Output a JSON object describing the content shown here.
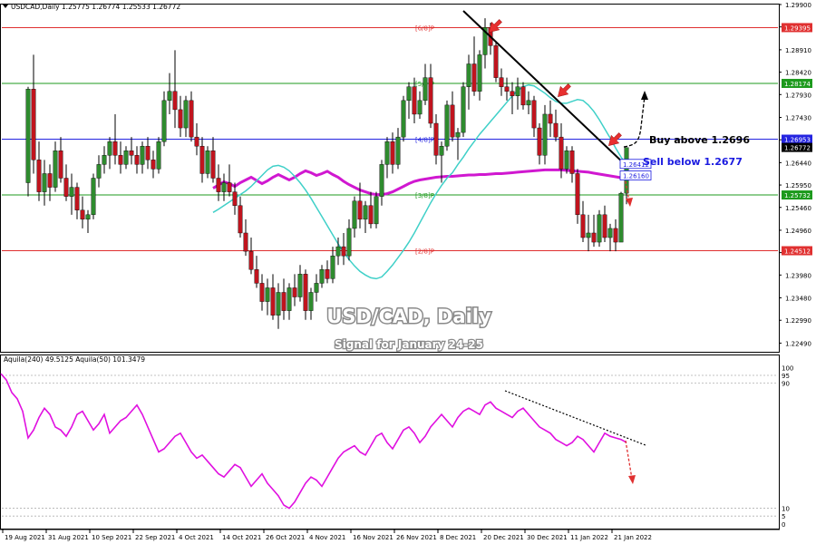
{
  "chart_data": [
    {
      "type": "candlestick",
      "symbol_header": "USDCAD,Daily  1.25775 1.26774 1.25533 1.26772",
      "title": "USD/CAD, Daily",
      "subtitle": "Signal for January 24-25",
      "ylim": [
        1.223,
        1.299
      ],
      "y_ticks": [
        "1.29900",
        "1.29410",
        "1.28910",
        "1.28420",
        "1.27930",
        "1.27430",
        "1.26940",
        "1.26440",
        "1.25950",
        "1.25460",
        "1.24960",
        "1.24470",
        "1.23980",
        "1.23480",
        "1.22990",
        "1.22490"
      ],
      "x_tick_labels": [
        "19 Aug 2021",
        "31 Aug 2021",
        "10 Sep 2021",
        "22 Sep 2021",
        "4 Oct 2021",
        "14 Oct 2021",
        "26 Oct 2021",
        "4 Nov 2021",
        "16 Nov 2021",
        "26 Nov 2021",
        "8 Dec 2021",
        "20 Dec 2021",
        "30 Dec 2021",
        "11 Jan 2022",
        "21 Jan 2022"
      ],
      "x_tick_bar_index": [
        0,
        8,
        16,
        24,
        32,
        40,
        48,
        56,
        64,
        72,
        80,
        88,
        96,
        104,
        112
      ],
      "bar_count": 115,
      "up_color": "#2e8b2e",
      "down_color": "#c0141e",
      "horizontal_levels": [
        {
          "label": "[6/8]P",
          "value": "1.29395",
          "price": 1.29395,
          "color": "#e03030"
        },
        {
          "label": "[5/8]P",
          "value": "1.28174",
          "price": 1.28174,
          "color": "#1d9a1d"
        },
        {
          "label": "[4/8]P",
          "value": "1.26953",
          "price": 1.26953,
          "color": "#2424e0"
        },
        {
          "label": "[3/8]P",
          "value": "1.25732",
          "price": 1.25732,
          "color": "#1d9a1d"
        },
        {
          "label": "[2/8]P",
          "value": "1.24512",
          "price": 1.24512,
          "color": "#e03030"
        }
      ],
      "price_tags": [
        {
          "value": "1.26772",
          "price": 1.26772,
          "bg": "#000000",
          "fg": "#ffffff"
        },
        {
          "value": "1.26412",
          "price": 1.26412,
          "bg": "#ffffff",
          "fg": "#1a1ae0"
        },
        {
          "value": "1.26160",
          "price": 1.2616,
          "bg": "#ffffff",
          "fg": "#1a1ae0"
        }
      ],
      "annotations": [
        {
          "text": "Buy above 1.2696",
          "color": "#000000"
        },
        {
          "text": "Sell below 1.2677",
          "color": "#1a1ae0"
        }
      ],
      "series": [
        {
          "name": "",
          "kind": "moving_average",
          "color": "#d018d0",
          "values": [
            1.2588,
            1.2595,
            1.2602,
            1.2598,
            1.2592,
            1.26,
            1.2606,
            1.2612,
            1.2605,
            1.2598,
            1.2604,
            1.2612,
            1.2618,
            1.2612,
            1.2606,
            1.2612,
            1.262,
            1.2626,
            1.2622,
            1.2616,
            1.262,
            1.2625,
            1.2618,
            1.2612,
            1.2603,
            1.2596,
            1.259,
            1.2584,
            1.258,
            1.2576,
            1.2574,
            1.2574,
            1.2576,
            1.258,
            1.2586,
            1.2592,
            1.2598,
            1.2603,
            1.2606,
            1.2608,
            1.261,
            1.2612,
            1.2613,
            1.2614,
            1.2614,
            1.2615,
            1.2616,
            1.2617,
            1.2617,
            1.2618,
            1.2618,
            1.2619,
            1.262,
            1.262,
            1.2621,
            1.2622,
            1.2623,
            1.2624,
            1.2625,
            1.2626,
            1.2627,
            1.2628,
            1.2628,
            1.2628,
            1.2628,
            1.2627,
            1.2626,
            1.2625,
            1.2624,
            1.2623,
            1.2621,
            1.2619,
            1.2617,
            1.2615,
            1.2613,
            1.2611,
            1.2609
          ]
        },
        {
          "name": "",
          "kind": "moving_average",
          "color": "#3fd0c8",
          "values": [
            1.2535,
            1.2542,
            1.255,
            1.2558,
            1.2566,
            1.2574,
            1.2582,
            1.2592,
            1.2604,
            1.2616,
            1.2628,
            1.2636,
            1.2638,
            1.2634,
            1.2626,
            1.2614,
            1.26,
            1.2584,
            1.2566,
            1.2546,
            1.2526,
            1.2506,
            1.2486,
            1.2466,
            1.2448,
            1.2432,
            1.2418,
            1.2406,
            1.2398,
            1.2392,
            1.239,
            1.2394,
            1.2406,
            1.242,
            1.2436,
            1.2452,
            1.247,
            1.249,
            1.2512,
            1.2534,
            1.2556,
            1.2576,
            1.2594,
            1.261,
            1.2622,
            1.264,
            1.2656,
            1.2674,
            1.269,
            1.2706,
            1.272,
            1.2734,
            1.2748,
            1.2762,
            1.2776,
            1.279,
            1.2802,
            1.281,
            1.2814,
            1.2812,
            1.2804,
            1.2796,
            1.2786,
            1.2778,
            1.2774,
            1.2774,
            1.2778,
            1.2782,
            1.278,
            1.277,
            1.2756,
            1.2738,
            1.2718,
            1.2698,
            1.2676,
            1.2656,
            1.2641
          ]
        }
      ],
      "candles": [
        [
          1.26,
          1.281,
          1.257,
          1.2805
        ],
        [
          1.2805,
          1.288,
          1.262,
          1.265
        ],
        [
          1.265,
          1.269,
          1.256,
          1.258
        ],
        [
          1.258,
          1.265,
          1.255,
          1.262
        ],
        [
          1.262,
          1.264,
          1.256,
          1.259
        ],
        [
          1.259,
          1.269,
          1.258,
          1.267
        ],
        [
          1.267,
          1.27,
          1.26,
          1.261
        ],
        [
          1.261,
          1.264,
          1.256,
          1.257
        ],
        [
          1.257,
          1.262,
          1.253,
          1.259
        ],
        [
          1.259,
          1.26,
          1.252,
          1.254
        ],
        [
          1.254,
          1.257,
          1.25,
          1.252
        ],
        [
          1.252,
          1.254,
          1.249,
          1.253
        ],
        [
          1.253,
          1.262,
          1.252,
          1.261
        ],
        [
          1.261,
          1.266,
          1.259,
          1.264
        ],
        [
          1.264,
          1.268,
          1.262,
          1.266
        ],
        [
          1.266,
          1.27,
          1.263,
          1.269
        ],
        [
          1.269,
          1.275,
          1.264,
          1.266
        ],
        [
          1.266,
          1.269,
          1.262,
          1.264
        ],
        [
          1.264,
          1.268,
          1.263,
          1.267
        ],
        [
          1.267,
          1.27,
          1.264,
          1.266
        ],
        [
          1.266,
          1.268,
          1.262,
          1.264
        ],
        [
          1.264,
          1.269,
          1.262,
          1.268
        ],
        [
          1.268,
          1.27,
          1.263,
          1.265
        ],
        [
          1.265,
          1.267,
          1.261,
          1.263
        ],
        [
          1.263,
          1.27,
          1.262,
          1.269
        ],
        [
          1.269,
          1.28,
          1.268,
          1.278
        ],
        [
          1.278,
          1.284,
          1.275,
          1.28
        ],
        [
          1.28,
          1.289,
          1.272,
          1.276
        ],
        [
          1.276,
          1.279,
          1.27,
          1.272
        ],
        [
          1.272,
          1.279,
          1.27,
          1.278
        ],
        [
          1.278,
          1.28,
          1.269,
          1.27
        ],
        [
          1.27,
          1.273,
          1.266,
          1.268
        ],
        [
          1.268,
          1.27,
          1.26,
          1.262
        ],
        [
          1.262,
          1.268,
          1.261,
          1.267
        ],
        [
          1.267,
          1.27,
          1.26,
          1.261
        ],
        [
          1.261,
          1.264,
          1.256,
          1.258
        ],
        [
          1.258,
          1.262,
          1.256,
          1.26
        ],
        [
          1.26,
          1.264,
          1.257,
          1.258
        ],
        [
          1.258,
          1.26,
          1.253,
          1.255
        ],
        [
          1.255,
          1.257,
          1.248,
          1.249
        ],
        [
          1.249,
          1.252,
          1.244,
          1.245
        ],
        [
          1.245,
          1.248,
          1.24,
          1.241
        ],
        [
          1.241,
          1.244,
          1.237,
          1.238
        ],
        [
          1.238,
          1.24,
          1.232,
          1.234
        ],
        [
          1.234,
          1.239,
          1.231,
          1.237
        ],
        [
          1.237,
          1.24,
          1.23,
          1.231
        ],
        [
          1.231,
          1.238,
          1.228,
          1.236
        ],
        [
          1.236,
          1.239,
          1.23,
          1.232
        ],
        [
          1.232,
          1.238,
          1.23,
          1.237
        ],
        [
          1.237,
          1.24,
          1.233,
          1.235
        ],
        [
          1.235,
          1.242,
          1.234,
          1.24
        ],
        [
          1.24,
          1.241,
          1.23,
          1.232
        ],
        [
          1.232,
          1.237,
          1.23,
          1.236
        ],
        [
          1.236,
          1.24,
          1.234,
          1.238
        ],
        [
          1.238,
          1.242,
          1.237,
          1.241
        ],
        [
          1.241,
          1.243,
          1.238,
          1.239
        ],
        [
          1.239,
          1.246,
          1.238,
          1.244
        ],
        [
          1.244,
          1.248,
          1.242,
          1.246
        ],
        [
          1.246,
          1.249,
          1.242,
          1.244
        ],
        [
          1.244,
          1.252,
          1.243,
          1.25
        ],
        [
          1.25,
          1.257,
          1.248,
          1.256
        ],
        [
          1.256,
          1.26,
          1.25,
          1.252
        ],
        [
          1.252,
          1.256,
          1.249,
          1.255
        ],
        [
          1.255,
          1.258,
          1.25,
          1.251
        ],
        [
          1.251,
          1.258,
          1.25,
          1.257
        ],
        [
          1.257,
          1.265,
          1.255,
          1.264
        ],
        [
          1.264,
          1.27,
          1.261,
          1.269
        ],
        [
          1.269,
          1.271,
          1.262,
          1.264
        ],
        [
          1.264,
          1.272,
          1.263,
          1.27
        ],
        [
          1.27,
          1.279,
          1.269,
          1.278
        ],
        [
          1.278,
          1.282,
          1.274,
          1.281
        ],
        [
          1.281,
          1.283,
          1.273,
          1.275
        ],
        [
          1.275,
          1.28,
          1.274,
          1.278
        ],
        [
          1.278,
          1.286,
          1.277,
          1.283
        ],
        [
          1.283,
          1.286,
          1.272,
          1.273
        ],
        [
          1.273,
          1.275,
          1.264,
          1.266
        ],
        [
          1.266,
          1.269,
          1.26,
          1.268
        ],
        [
          1.268,
          1.278,
          1.267,
          1.277
        ],
        [
          1.277,
          1.28,
          1.269,
          1.27
        ],
        [
          1.27,
          1.272,
          1.265,
          1.271
        ],
        [
          1.271,
          1.282,
          1.27,
          1.281
        ],
        [
          1.281,
          1.288,
          1.276,
          1.286
        ],
        [
          1.286,
          1.292,
          1.279,
          1.28
        ],
        [
          1.28,
          1.289,
          1.278,
          1.288
        ],
        [
          1.288,
          1.296,
          1.285,
          1.294
        ],
        [
          1.294,
          1.295,
          1.288,
          1.29
        ],
        [
          1.29,
          1.291,
          1.282,
          1.283
        ],
        [
          1.283,
          1.285,
          1.279,
          1.281
        ],
        [
          1.281,
          1.283,
          1.278,
          1.28
        ],
        [
          1.28,
          1.282,
          1.275,
          1.279
        ],
        [
          1.279,
          1.283,
          1.276,
          1.281
        ],
        [
          1.281,
          1.282,
          1.276,
          1.277
        ],
        [
          1.277,
          1.28,
          1.275,
          1.278
        ],
        [
          1.278,
          1.279,
          1.27,
          1.272
        ],
        [
          1.272,
          1.273,
          1.264,
          1.266
        ],
        [
          1.266,
          1.277,
          1.264,
          1.275
        ],
        [
          1.275,
          1.278,
          1.27,
          1.273
        ],
        [
          1.273,
          1.276,
          1.269,
          1.27
        ],
        [
          1.27,
          1.273,
          1.261,
          1.263
        ],
        [
          1.263,
          1.268,
          1.262,
          1.267
        ],
        [
          1.267,
          1.268,
          1.26,
          1.262
        ],
        [
          1.262,
          1.263,
          1.251,
          1.253
        ],
        [
          1.253,
          1.256,
          1.247,
          1.248
        ],
        [
          1.248,
          1.253,
          1.245,
          1.249
        ],
        [
          1.249,
          1.253,
          1.246,
          1.247
        ],
        [
          1.247,
          1.254,
          1.246,
          1.253
        ],
        [
          1.253,
          1.255,
          1.247,
          1.248
        ],
        [
          1.248,
          1.251,
          1.245,
          1.25
        ],
        [
          1.25,
          1.252,
          1.245,
          1.247
        ],
        [
          1.247,
          1.258,
          1.247,
          1.2577
        ],
        [
          1.2577,
          1.2677,
          1.2553,
          1.2677
        ]
      ]
    },
    {
      "type": "line",
      "header": "Aquila(240) 49.5125  Aquila(50) 101.3479",
      "ylim": [
        -3,
        106
      ],
      "y_ticks": [
        "100",
        "95",
        "90",
        "10",
        "5",
        "0"
      ],
      "series": [
        {
          "name": "",
          "color": "#e010e0",
          "values": [
            96,
            92,
            84,
            80,
            72,
            55,
            60,
            68,
            74,
            70,
            62,
            60,
            56,
            62,
            70,
            72,
            66,
            60,
            64,
            70,
            58,
            62,
            66,
            68,
            72,
            76,
            70,
            62,
            54,
            46,
            48,
            52,
            56,
            58,
            52,
            46,
            42,
            44,
            40,
            36,
            32,
            30,
            34,
            38,
            36,
            30,
            24,
            28,
            32,
            26,
            22,
            18,
            12,
            10,
            14,
            20,
            26,
            30,
            28,
            24,
            30,
            36,
            42,
            46,
            48,
            50,
            46,
            44,
            50,
            56,
            58,
            52,
            48,
            54,
            60,
            62,
            58,
            52,
            56,
            62,
            66,
            70,
            66,
            62,
            68,
            72,
            74,
            72,
            70,
            76,
            78,
            74,
            72,
            70,
            68,
            72,
            74,
            70,
            66,
            62,
            60,
            58,
            54,
            52,
            50,
            52,
            56,
            54,
            50,
            46,
            52,
            58,
            56,
            55,
            54,
            52
          ]
        }
      ],
      "trendline_label": ""
    }
  ]
}
